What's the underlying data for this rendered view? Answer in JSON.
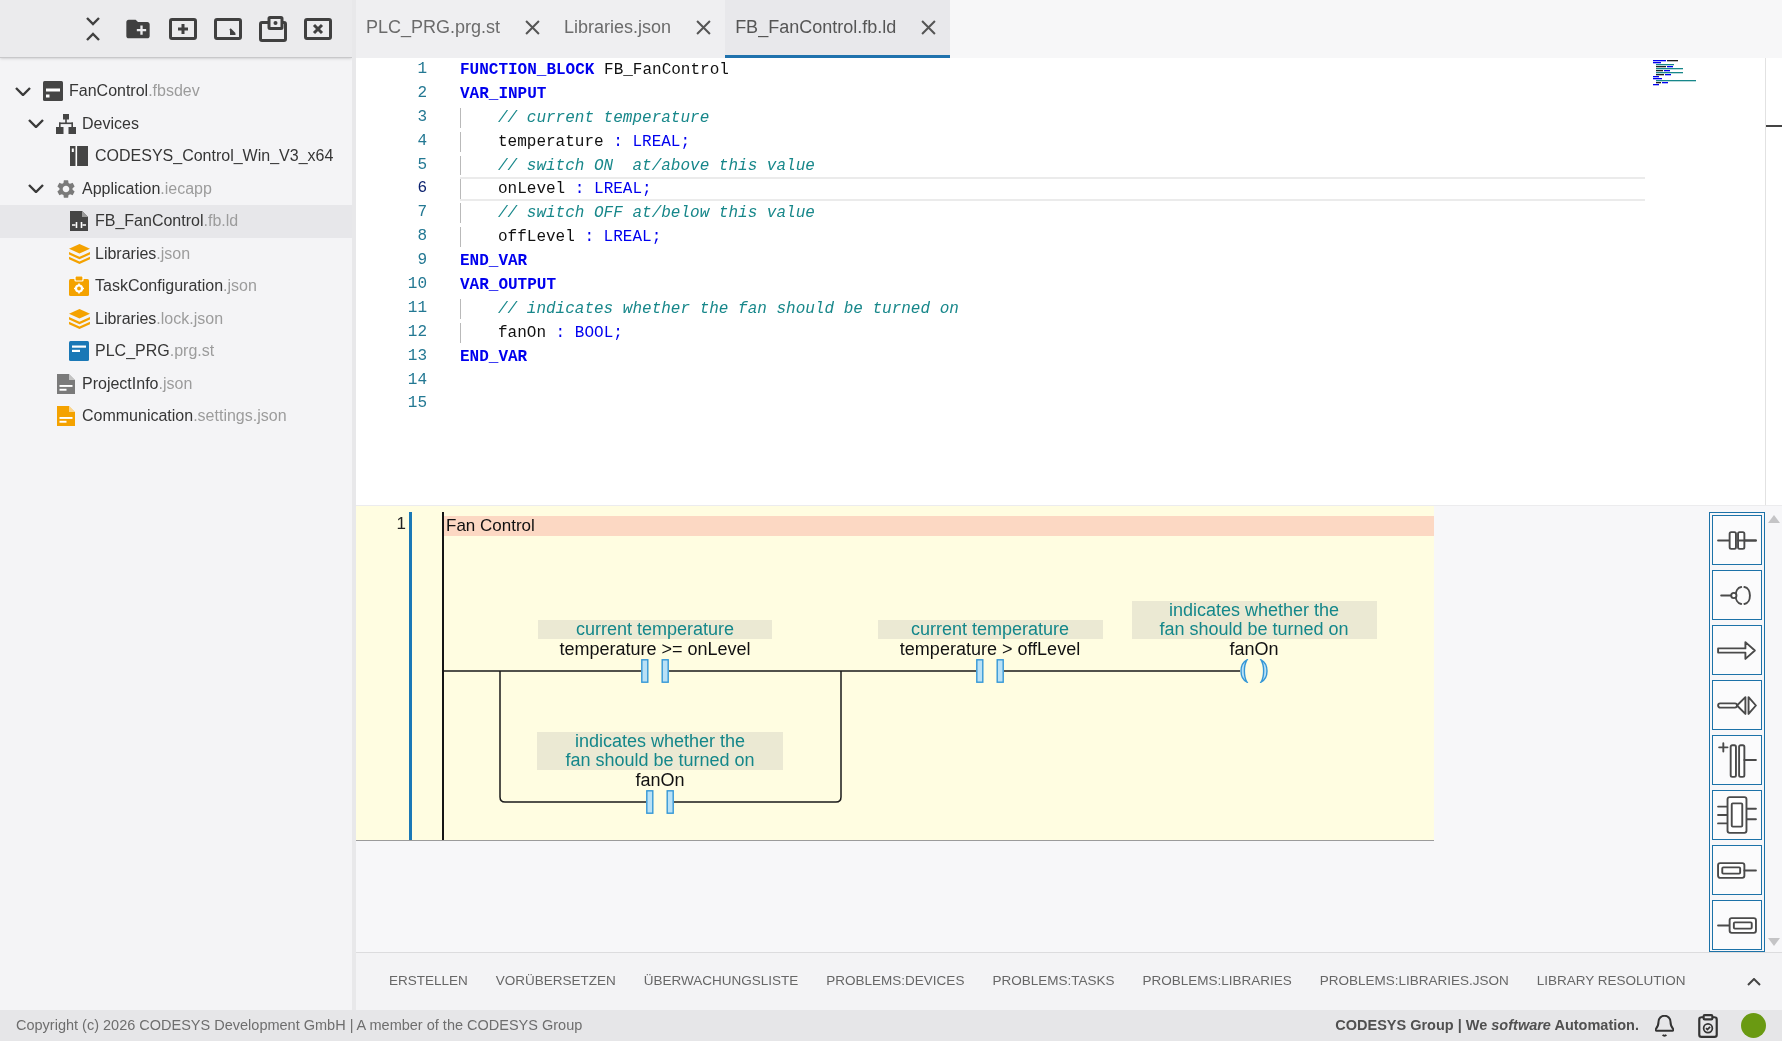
{
  "sidebar": {
    "tree": [
      {
        "name": "FanControl",
        "extension": ".fbsdev",
        "kind": "project",
        "expanded": true,
        "selected": false,
        "children": [
          {
            "name": "Devices",
            "kind": "devices",
            "expanded": true,
            "selected": false,
            "children": [
              {
                "name": "CODESYS_Control_Win_V3_x64",
                "kind": "device",
                "selected": false
              }
            ]
          },
          {
            "name": "Application",
            "extension": ".iecapp",
            "kind": "application",
            "expanded": true,
            "selected": false,
            "children": [
              {
                "name": "FB_FanControl",
                "extension": ".fb.ld",
                "kind": "ladder",
                "selected": true
              },
              {
                "name": "Libraries",
                "extension": ".json",
                "kind": "library",
                "selected": false
              },
              {
                "name": "TaskConfiguration",
                "extension": ".json",
                "kind": "task",
                "selected": false
              },
              {
                "name": "Libraries",
                "extension": ".lock.json",
                "kind": "library",
                "selected": false
              },
              {
                "name": "PLC_PRG",
                "extension": ".prg.st",
                "kind": "structured-text",
                "selected": false
              }
            ]
          },
          {
            "name": "ProjectInfo",
            "extension": ".json",
            "kind": "info",
            "selected": false
          },
          {
            "name": "Communication",
            "extension": ".settings.json",
            "kind": "settings",
            "selected": false
          }
        ]
      }
    ]
  },
  "editor": {
    "tabs": [
      {
        "label": "PLC_PRG.prg.st",
        "selected": false
      },
      {
        "label": "Libraries.json",
        "selected": false
      },
      {
        "label": "FB_FanControl.fb.ld",
        "selected": true
      }
    ],
    "code_lines": [
      {
        "number": "1",
        "current": false,
        "tokens": [
          {
            "kind": "keyword",
            "text": "FUNCTION_BLOCK"
          },
          {
            "kind": "plain",
            "text": " FB_FanControl"
          }
        ]
      },
      {
        "number": "2",
        "current": false,
        "tokens": [
          {
            "kind": "keyword",
            "text": "VAR_INPUT"
          }
        ],
        "children": [
          {
            "number": "3",
            "current": false,
            "tokens": [
              {
                "kind": "comment",
                "text": "// current temperature"
              }
            ]
          },
          {
            "number": "4",
            "current": false,
            "tokens": [
              {
                "kind": "plain",
                "text": "temperature"
              },
              {
                "kind": "type",
                "text": " : LREAL;"
              }
            ]
          },
          {
            "number": "5",
            "current": false,
            "tokens": [
              {
                "kind": "comment",
                "text": "// switch ON  at/above this value"
              }
            ]
          },
          {
            "number": "6",
            "current": true,
            "tokens": [
              {
                "kind": "plain",
                "text": "onLevel"
              },
              {
                "kind": "type",
                "text": " : LREAL;"
              }
            ]
          },
          {
            "number": "7",
            "current": false,
            "tokens": [
              {
                "kind": "comment",
                "text": "// switch OFF at/below this value"
              }
            ]
          },
          {
            "number": "8",
            "current": false,
            "tokens": [
              {
                "kind": "plain",
                "text": "offLevel"
              },
              {
                "kind": "type",
                "text": " : LREAL;"
              }
            ]
          }
        ]
      },
      {
        "number": "9",
        "current": false,
        "tokens": [
          {
            "kind": "keyword",
            "text": "END_VAR"
          }
        ]
      },
      {
        "number": "10",
        "current": false,
        "tokens": [
          {
            "kind": "keyword",
            "text": "VAR_OUTPUT"
          }
        ],
        "children": [
          {
            "number": "11",
            "current": false,
            "tokens": [
              {
                "kind": "comment",
                "text": "// indicates whether the fan should be turned on"
              }
            ]
          },
          {
            "number": "12",
            "current": false,
            "tokens": [
              {
                "kind": "plain",
                "text": "fanOn"
              },
              {
                "kind": "type",
                "text": " : BOOL;"
              }
            ]
          }
        ]
      },
      {
        "number": "13",
        "current": false,
        "tokens": [
          {
            "kind": "keyword",
            "text": "END_VAR"
          }
        ]
      },
      {
        "number": "14",
        "current": false
      },
      {
        "number": "15",
        "current": false
      }
    ]
  },
  "ladder": {
    "networks": [
      {
        "number": "1",
        "title": "Fan Control",
        "elements": [
          {
            "kind": "contact",
            "comment": "current temperature",
            "variable": "temperature >= onLevel"
          },
          {
            "kind": "contact",
            "comment": "indicates whether the fan should be turned on",
            "variable": "fanOn"
          },
          {
            "kind": "contact",
            "comment": "current temperature",
            "variable": "temperature > offLevel"
          },
          {
            "kind": "coil",
            "comment": "indicates whether the fan should be turned on",
            "variable": "fanOn"
          }
        ]
      }
    ]
  },
  "bottom_panel": {
    "tabs": [
      "ERSTELLEN",
      "VORÜBERSETZEN",
      "ÜBERWACHUNGSLISTE",
      "PROBLEMS:DEVICES",
      "PROBLEMS:TASKS",
      "PROBLEMS:LIBRARIES",
      "PROBLEMS:LIBRARIES.JSON",
      "LIBRARY RESOLUTION"
    ]
  },
  "status_bar": {
    "copyright": "Copyright (c) 2026 CODESYS Development GmbH | A member of the CODESYS Group",
    "tagline": "CODESYS Group | We *software* Automation."
  }
}
